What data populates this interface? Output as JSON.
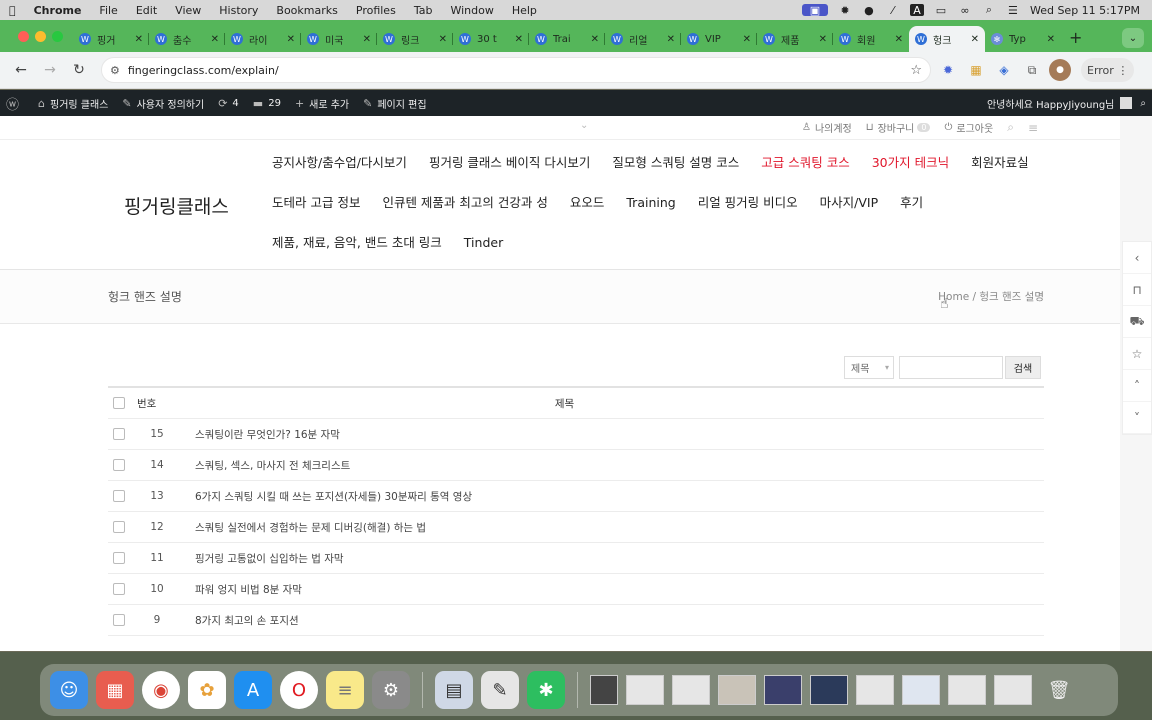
{
  "menubar": {
    "app": "Chrome",
    "items": [
      "File",
      "Edit",
      "View",
      "History",
      "Bookmarks",
      "Profiles",
      "Tab",
      "Window",
      "Help"
    ],
    "datetime": "Wed Sep 11  5:17PM"
  },
  "tabs": [
    {
      "label": "핑거"
    },
    {
      "label": "춤수"
    },
    {
      "label": "라이"
    },
    {
      "label": "미국"
    },
    {
      "label": "링크"
    },
    {
      "label": "30 t"
    },
    {
      "label": "Trai"
    },
    {
      "label": "리얼"
    },
    {
      "label": "VIP"
    },
    {
      "label": "제품"
    },
    {
      "label": "회원"
    },
    {
      "label": "헝크",
      "active": true
    },
    {
      "label": "Typ"
    }
  ],
  "toolbar": {
    "url": "fingeringclass.com/explain/",
    "error_label": "Error"
  },
  "wpbar": {
    "site": "핑거링 클래스",
    "customize": "사용자 정의하기",
    "updates": "4",
    "comments": "29",
    "new": "새로 추가",
    "edit": "페이지 편집",
    "greeting": "안녕하세요 HappyJiyoung님"
  },
  "topline": {
    "account": "나의계정",
    "cart": "장바구니",
    "cart_count": "0",
    "logout": "로그아웃"
  },
  "site": {
    "logo": "핑거링클래스",
    "nav": [
      {
        "label": "공지사항/춤수업/다시보기"
      },
      {
        "label": "핑거링 클래스 베이직 다시보기"
      },
      {
        "label": "질모형 스쿼팅 설명 코스"
      },
      {
        "label": "고급 스쿼팅 코스",
        "highlight": true
      },
      {
        "label": "30가지 테크닉",
        "highlight": true
      },
      {
        "label": "회원자료실"
      },
      {
        "label": "도테라 고급 정보"
      },
      {
        "label": "인큐텐 제품과 최고의 건강과 성"
      },
      {
        "label": "요오드"
      },
      {
        "label": "Training"
      },
      {
        "label": "리얼 핑거링 비디오"
      },
      {
        "label": "마사지/VIP"
      },
      {
        "label": "후기"
      },
      {
        "label": "제품, 재료, 음악, 밴드 초대 링크"
      },
      {
        "label": "Tinder"
      }
    ]
  },
  "titlebar": {
    "title": "헝크 핸즈 설명",
    "breadcrumb": "Home / 헝크 핸즈 설명"
  },
  "search": {
    "field_label": "제목",
    "button": "검색"
  },
  "table": {
    "header_num": "번호",
    "header_title": "제목",
    "rows": [
      {
        "num": "15",
        "title": "스쿼팅이란 무엇인가? 16분 자막"
      },
      {
        "num": "14",
        "title": "스쿼팅, 섹스, 마사지 전 체크리스트"
      },
      {
        "num": "13",
        "title": "6가지 스쿼팅 시킬 때 쓰는 포지션(자세들) 30분짜리 통역 영상"
      },
      {
        "num": "12",
        "title": "스쿼팅 실전에서 경험하는 문제 디버깅(해결) 하는 법"
      },
      {
        "num": "11",
        "title": "핑거링 고통없이 십입하는 법 자막"
      },
      {
        "num": "10",
        "title": "파워 엉지 비법 8분 자막"
      },
      {
        "num": "9",
        "title": "8가지 최고의 손 포지션"
      }
    ]
  }
}
